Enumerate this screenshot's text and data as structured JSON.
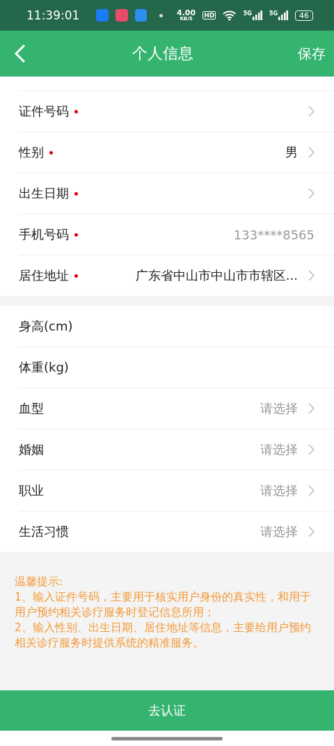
{
  "status_bar": {
    "time": "11:39:01",
    "speed": "4.00",
    "speed_unit": "KB/S",
    "hd": "HD",
    "networks": [
      "5G",
      "5G"
    ],
    "battery": "46"
  },
  "header": {
    "title": "个人信息",
    "action": "保存"
  },
  "groups": [
    {
      "rows": [
        {
          "kind": "select",
          "label": "证件号码",
          "required": true
        },
        {
          "kind": "select",
          "label": "性别",
          "required": true,
          "value": "男"
        },
        {
          "kind": "select",
          "label": "出生日期",
          "required": true
        },
        {
          "kind": "input",
          "label": "手机号码",
          "required": true,
          "placeholder": "133****8565"
        },
        {
          "kind": "select",
          "label": "居住地址",
          "required": true,
          "value": "广东省中山市中山市市辖区..."
        }
      ]
    },
    {
      "rows": [
        {
          "kind": "input",
          "label": "身高(cm)",
          "required": false
        },
        {
          "kind": "input",
          "label": "体重(kg)",
          "required": false
        },
        {
          "kind": "select",
          "label": "血型",
          "required": false,
          "placeholder": "请选择"
        },
        {
          "kind": "select",
          "label": "婚姻",
          "required": false,
          "placeholder": "请选择"
        },
        {
          "kind": "select",
          "label": "职业",
          "required": false,
          "placeholder": "请选择"
        },
        {
          "kind": "select",
          "label": "生活习惯",
          "required": false,
          "placeholder": "请选择"
        }
      ]
    }
  ],
  "tips": {
    "title": "温馨提示:",
    "items": [
      "1、输入证件号码，主要用于核实用户身份的真实性，和用于用户预约相关诊疗服务时登记信息所用；",
      "2、输入性别、出生日期、居住地址等信息，主要给用户预约相关诊疗服务时提供系统的精准服务。"
    ]
  },
  "submit": "去认证"
}
